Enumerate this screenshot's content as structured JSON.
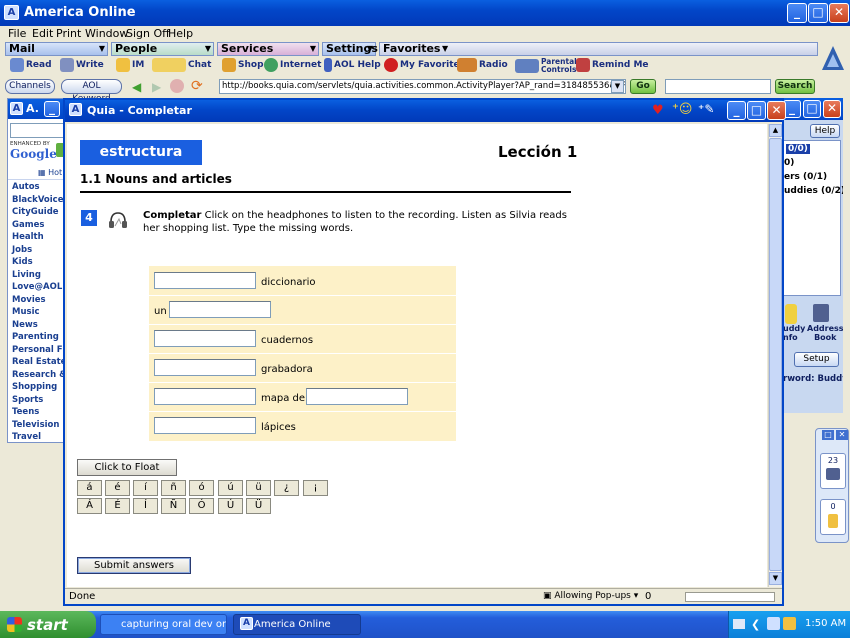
{
  "aol": {
    "title": "America  Online",
    "menu": [
      "File",
      "Edit",
      "Print",
      "Window",
      "Sign Off",
      "Help"
    ],
    "tab_headers": [
      "Mail",
      "People",
      "Services",
      "Settings",
      "Favorites"
    ],
    "toolbar": [
      "Read",
      "Write",
      "IM",
      "Chat",
      "Shop",
      "Internet",
      "AOL Help",
      "My Favorites",
      "Radio",
      "Parental Controls",
      "Remind Me"
    ],
    "channels_btn": "Channels",
    "keyword_btn": "AOL Keyword",
    "url": "http://books.quia.com/servlets/quia.activities.common.ActivityPlayer?AP_rand=318485536&AP_a",
    "go_btn": "Go",
    "search_btn": "Search"
  },
  "left_sidebar": {
    "title": "A.",
    "enhanced_by": "ENHANCED BY",
    "google": "Google",
    "hot": "Hot S",
    "categories": [
      "Autos",
      "BlackVoices",
      "CityGuide",
      "Games",
      "Health",
      "Jobs",
      "Kids",
      "Living",
      "Love@AOL",
      "Movies",
      "Music",
      "News",
      "Parenting",
      "Personal Finar",
      "Real Estate",
      "Research & Le",
      "Shopping",
      "Sports",
      "Teens",
      "Television",
      "Travel"
    ]
  },
  "right_sidebar": {
    "help": "Help",
    "list": [
      "0/0)",
      "0)",
      "ers (0/1)",
      "uddies (0/2)"
    ],
    "buddy_info": "uddy\nnfo",
    "address_book": "Address\nBook",
    "setup": "Setup",
    "password": "rword: Buddy",
    "counters": [
      "23",
      "0"
    ]
  },
  "quia": {
    "title": "Quia - Completar",
    "section_badge": "estructura",
    "lesson": "Lección 1",
    "subtitle": "1.1 Nouns and articles",
    "exercise_num": "4",
    "instr_bold": "Completar",
    "instr_text": " Click on the headphones to listen to the recording. Listen as Silvia reads her shopping list. Type the missing words.",
    "rows": [
      {
        "before": "",
        "after": "diccionario",
        "second": false
      },
      {
        "before": "un",
        "after": "",
        "second": false
      },
      {
        "before": "",
        "after": "cuadernos",
        "second": false
      },
      {
        "before": "",
        "after": "grabadora",
        "second": false
      },
      {
        "before": "",
        "after": "mapa de",
        "second": true
      },
      {
        "before": "",
        "after": "lápices",
        "second": false
      }
    ],
    "float_btn": "Click to Float",
    "accents_lower": [
      "á",
      "é",
      "í",
      "ñ",
      "ó",
      "ú",
      "ü",
      "¿",
      "¡"
    ],
    "accents_upper": [
      "Á",
      "É",
      "Í",
      "Ñ",
      "Ó",
      "Ú",
      "Ü"
    ],
    "submit": "Submit answers",
    "status_done": "Done",
    "status_popups": "Allowing Pop-ups",
    "status_count": "0"
  },
  "taskbar": {
    "start": "start",
    "tasks": [
      "capturing oral dev onl...",
      "America  Online"
    ],
    "time": "1:50 AM"
  },
  "colors": {
    "xp_blue": "#0246c8",
    "badge": "#1a5fe0",
    "table_bg": "#fdf1c8"
  }
}
